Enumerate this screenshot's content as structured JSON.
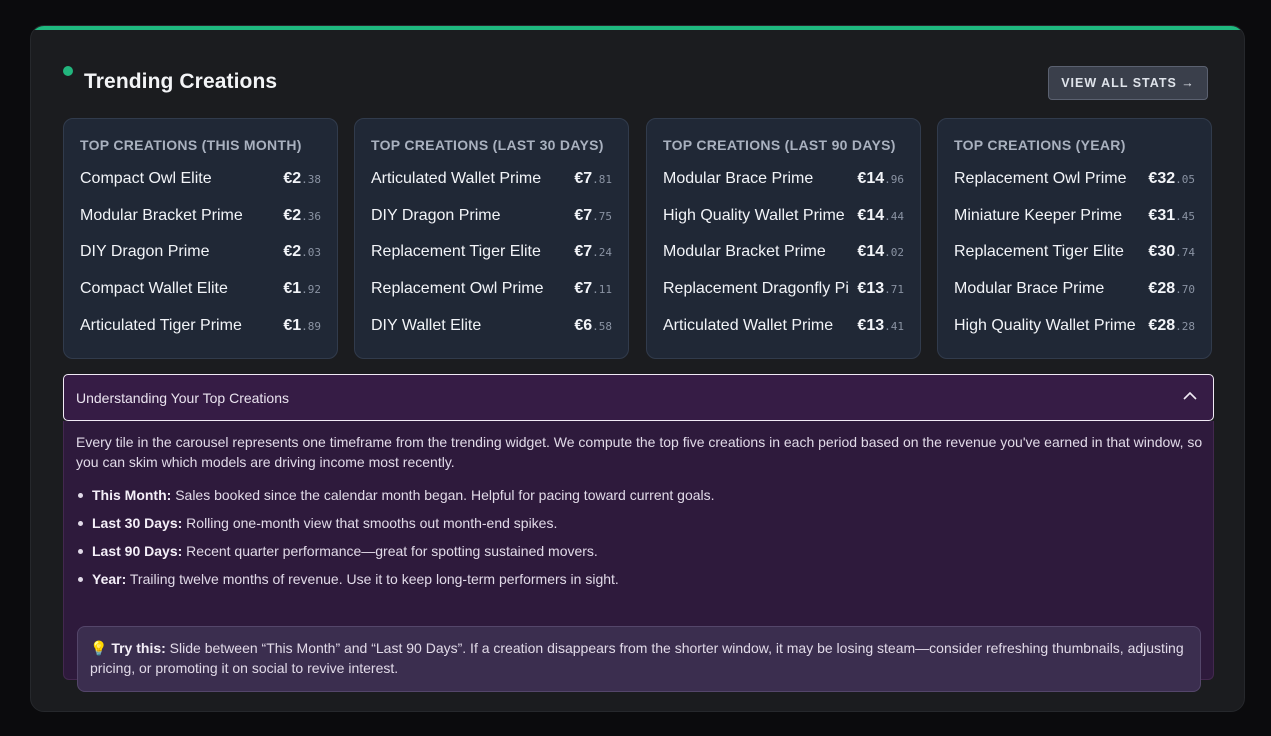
{
  "header": {
    "title": "Trending Creations",
    "view_all_label": "VIEW ALL STATS →"
  },
  "cards": [
    {
      "title": "TOP CREATIONS (THIS MONTH)",
      "items": [
        {
          "name": "Compact Owl Elite",
          "price": "€2",
          "cents": ".38"
        },
        {
          "name": "Modular Bracket Prime",
          "price": "€2",
          "cents": ".36"
        },
        {
          "name": "DIY Dragon Prime",
          "price": "€2",
          "cents": ".03"
        },
        {
          "name": "Compact Wallet Elite",
          "price": "€1",
          "cents": ".92"
        },
        {
          "name": "Articulated Tiger Prime",
          "price": "€1",
          "cents": ".89"
        }
      ]
    },
    {
      "title": "TOP CREATIONS (LAST 30 DAYS)",
      "items": [
        {
          "name": "Articulated Wallet Prime",
          "price": "€7",
          "cents": ".81"
        },
        {
          "name": "DIY Dragon Prime",
          "price": "€7",
          "cents": ".75"
        },
        {
          "name": "Replacement Tiger Elite",
          "price": "€7",
          "cents": ".24"
        },
        {
          "name": "Replacement Owl Prime",
          "price": "€7",
          "cents": ".11"
        },
        {
          "name": "DIY Wallet Elite",
          "price": "€6",
          "cents": ".58"
        }
      ]
    },
    {
      "title": "TOP CREATIONS (LAST 90 DAYS)",
      "items": [
        {
          "name": "Modular Brace Prime",
          "price": "€14",
          "cents": ".96"
        },
        {
          "name": "High Quality Wallet Prime",
          "price": "€14",
          "cents": ".44"
        },
        {
          "name": "Modular Bracket Prime",
          "price": "€14",
          "cents": ".02"
        },
        {
          "name": "Replacement Dragonfly Pi",
          "price": "€13",
          "cents": ".71"
        },
        {
          "name": "Articulated Wallet Prime",
          "price": "€13",
          "cents": ".41"
        }
      ]
    },
    {
      "title": "TOP CREATIONS (YEAR)",
      "items": [
        {
          "name": "Replacement Owl Prime",
          "price": "€32",
          "cents": ".05"
        },
        {
          "name": "Miniature Keeper Prime",
          "price": "€31",
          "cents": ".45"
        },
        {
          "name": "Replacement Tiger Elite",
          "price": "€30",
          "cents": ".74"
        },
        {
          "name": "Modular Brace Prime",
          "price": "€28",
          "cents": ".70"
        },
        {
          "name": "High Quality Wallet Prime",
          "price": "€28",
          "cents": ".28"
        }
      ]
    }
  ],
  "accordion": {
    "title": "Understanding Your Top Creations",
    "expanded": true,
    "intro": "Every tile in the carousel represents one timeframe from the trending widget. We compute the top five creations in each period based on the revenue you've earned in that window, so you can skim which models are driving income most recently.",
    "bullets": [
      {
        "term": "This Month:",
        "text": " Sales booked since the calendar month began. Helpful for pacing toward current goals."
      },
      {
        "term": "Last 30 Days:",
        "text": " Rolling one-month view that smooths out month-end spikes."
      },
      {
        "term": "Last 90 Days:",
        "text": " Recent quarter performance—great for spotting sustained movers."
      },
      {
        "term": "Year:",
        "text": " Trailing twelve months of revenue. Use it to keep long-term performers in sight."
      }
    ],
    "tip": {
      "icon": "💡",
      "label": "Try this:",
      "text": " Slide between “This Month” and “Last 90 Days”. If a creation disappears from the shorter window, it may be losing steam—consider refreshing thumbnails, adjusting pricing, or promoting it on social to revive interest."
    }
  },
  "colors": {
    "accent": "#1fb97f",
    "card_bg": "#202836",
    "accordion_bg": "#2e1a3c"
  }
}
